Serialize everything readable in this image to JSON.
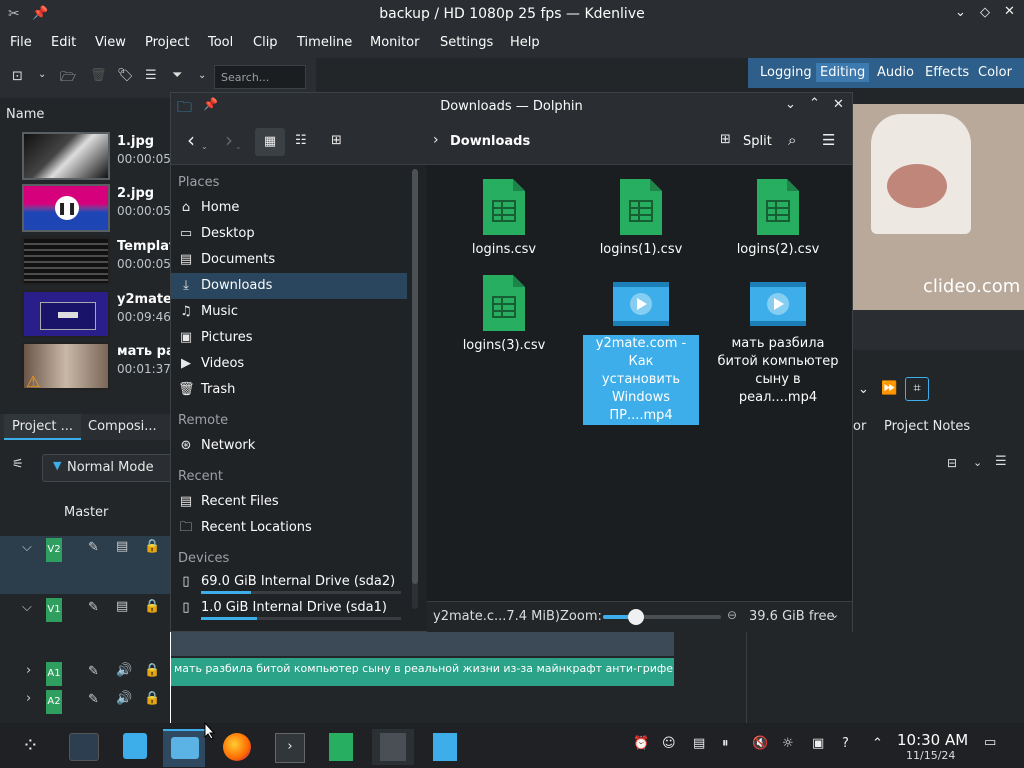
{
  "kdenlive": {
    "window_title": "backup / HD 1080p 25 fps — Kdenlive",
    "menu": [
      "File",
      "Edit",
      "View",
      "Project",
      "Tool",
      "Clip",
      "Timeline",
      "Monitor",
      "Settings",
      "Help"
    ],
    "workspaces": [
      "Logging",
      "Editing",
      "Audio",
      "Effects",
      "Color"
    ],
    "active_workspace": "Editing",
    "search_placeholder": "Search...",
    "bin_header": "Name",
    "clips": [
      {
        "name": "1.jpg",
        "duration": "00:00:05"
      },
      {
        "name": "2.jpg",
        "duration": "00:00:05"
      },
      {
        "name": "Templat",
        "duration": "00:00:05"
      },
      {
        "name": "y2mate.",
        "duration": "00:09:46"
      },
      {
        "name": "мать ра",
        "duration": "00:01:37"
      }
    ],
    "bottom_tabs": [
      "Project ...",
      "Composi..."
    ],
    "mode": "Normal Mode",
    "master_label": "Master",
    "tracks": [
      "V2",
      "V1",
      "A1",
      "A2"
    ],
    "right_tabs": [
      "or",
      "Project Notes"
    ],
    "preview_watermark": "clideo.com",
    "timeline_clip_text": "мать разбила битой компьютер сыну в реальной жизни из-за майнкрафт анти-грифер шоу #"
  },
  "dolphin": {
    "title": "Downloads — Dolphin",
    "breadcrumb": "Downloads",
    "split_label": "Split",
    "sections": {
      "places": "Places",
      "remote": "Remote",
      "recent": "Recent",
      "devices": "Devices"
    },
    "places": [
      {
        "label": "Home",
        "icon": "home-icon"
      },
      {
        "label": "Desktop",
        "icon": "desktop-icon"
      },
      {
        "label": "Documents",
        "icon": "documents-icon"
      },
      {
        "label": "Downloads",
        "icon": "downloads-icon"
      },
      {
        "label": "Music",
        "icon": "music-icon"
      },
      {
        "label": "Pictures",
        "icon": "pictures-icon"
      },
      {
        "label": "Videos",
        "icon": "videos-icon"
      },
      {
        "label": "Trash",
        "icon": "trash-icon"
      }
    ],
    "remote": [
      {
        "label": "Network",
        "icon": "network-icon"
      }
    ],
    "recent": [
      {
        "label": "Recent Files",
        "icon": "recent-files-icon"
      },
      {
        "label": "Recent Locations",
        "icon": "recent-locations-icon"
      }
    ],
    "devices": [
      {
        "label": "69.0 GiB Internal Drive (sda2)",
        "usage": 0.25
      },
      {
        "label": "1.0 GiB Internal Drive (sda1)",
        "usage": 0.28
      }
    ],
    "files": [
      {
        "name": "logins.csv",
        "type": "csv"
      },
      {
        "name": "logins(1).csv",
        "type": "csv"
      },
      {
        "name": "logins(2).csv",
        "type": "csv"
      },
      {
        "name": "logins(3).csv",
        "type": "csv"
      },
      {
        "name_lines": [
          "y2mate.com - Как",
          "установить",
          "Windows ПР....mp4"
        ],
        "type": "video",
        "selected": true
      },
      {
        "name_lines": [
          "мать разбила",
          "битой компьютер",
          "сыну в реал....mp4"
        ],
        "type": "video",
        "selected": false
      }
    ],
    "status": {
      "selection": "y2mate.c...7.4 MiB)",
      "zoom_label": "Zoom:",
      "zoom_level": 0.28,
      "free_space": "39.6 GiB free"
    }
  },
  "taskbar": {
    "time": "10:30 AM",
    "date": "11/15/24"
  },
  "colors": {
    "accent": "#3daee9",
    "selection": "#3daee9",
    "csv_green": "#27ae60",
    "video_blue": "#3daee9",
    "track_badge": "#2f9f5f"
  }
}
